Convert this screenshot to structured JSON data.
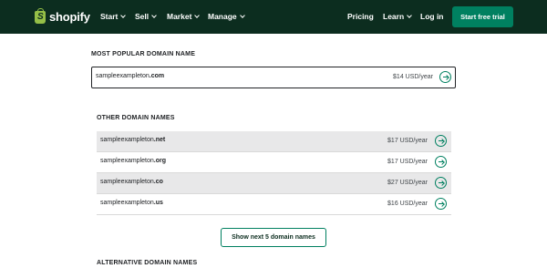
{
  "nav": {
    "logo_text": "shopify",
    "logo_mark": "S",
    "items": [
      {
        "label": "Start"
      },
      {
        "label": "Sell"
      },
      {
        "label": "Market"
      },
      {
        "label": "Manage"
      }
    ],
    "pricing": "Pricing",
    "learn": "Learn",
    "login": "Log in",
    "cta": "Start free trial"
  },
  "popular": {
    "heading": "MOST POPULAR DOMAIN NAME",
    "name": "sampleexampleton",
    "tld": ".com",
    "price": "$14 USD/year"
  },
  "other": {
    "heading": "OTHER DOMAIN NAMES",
    "rows": [
      {
        "name": "sampleexampleton",
        "tld": ".net",
        "price": "$17 USD/year"
      },
      {
        "name": "sampleexampleton",
        "tld": ".org",
        "price": "$17 USD/year"
      },
      {
        "name": "sampleexampleton",
        "tld": ".co",
        "price": "$27 USD/year"
      },
      {
        "name": "sampleexampleton",
        "tld": ".us",
        "price": "$16 USD/year"
      }
    ]
  },
  "more_button": "Show next 5 domain names",
  "alternative": {
    "heading": "ALTERNATIVE DOMAIN NAMES"
  },
  "colors": {
    "nav_bg": "#0c2d1f",
    "accent": "#008060",
    "logo": "#95bf47",
    "row_shade": "#e8e8e9"
  },
  "icons": [
    "shopify-logo-icon",
    "chevron-down-icon",
    "arrow-right-circle-icon"
  ]
}
